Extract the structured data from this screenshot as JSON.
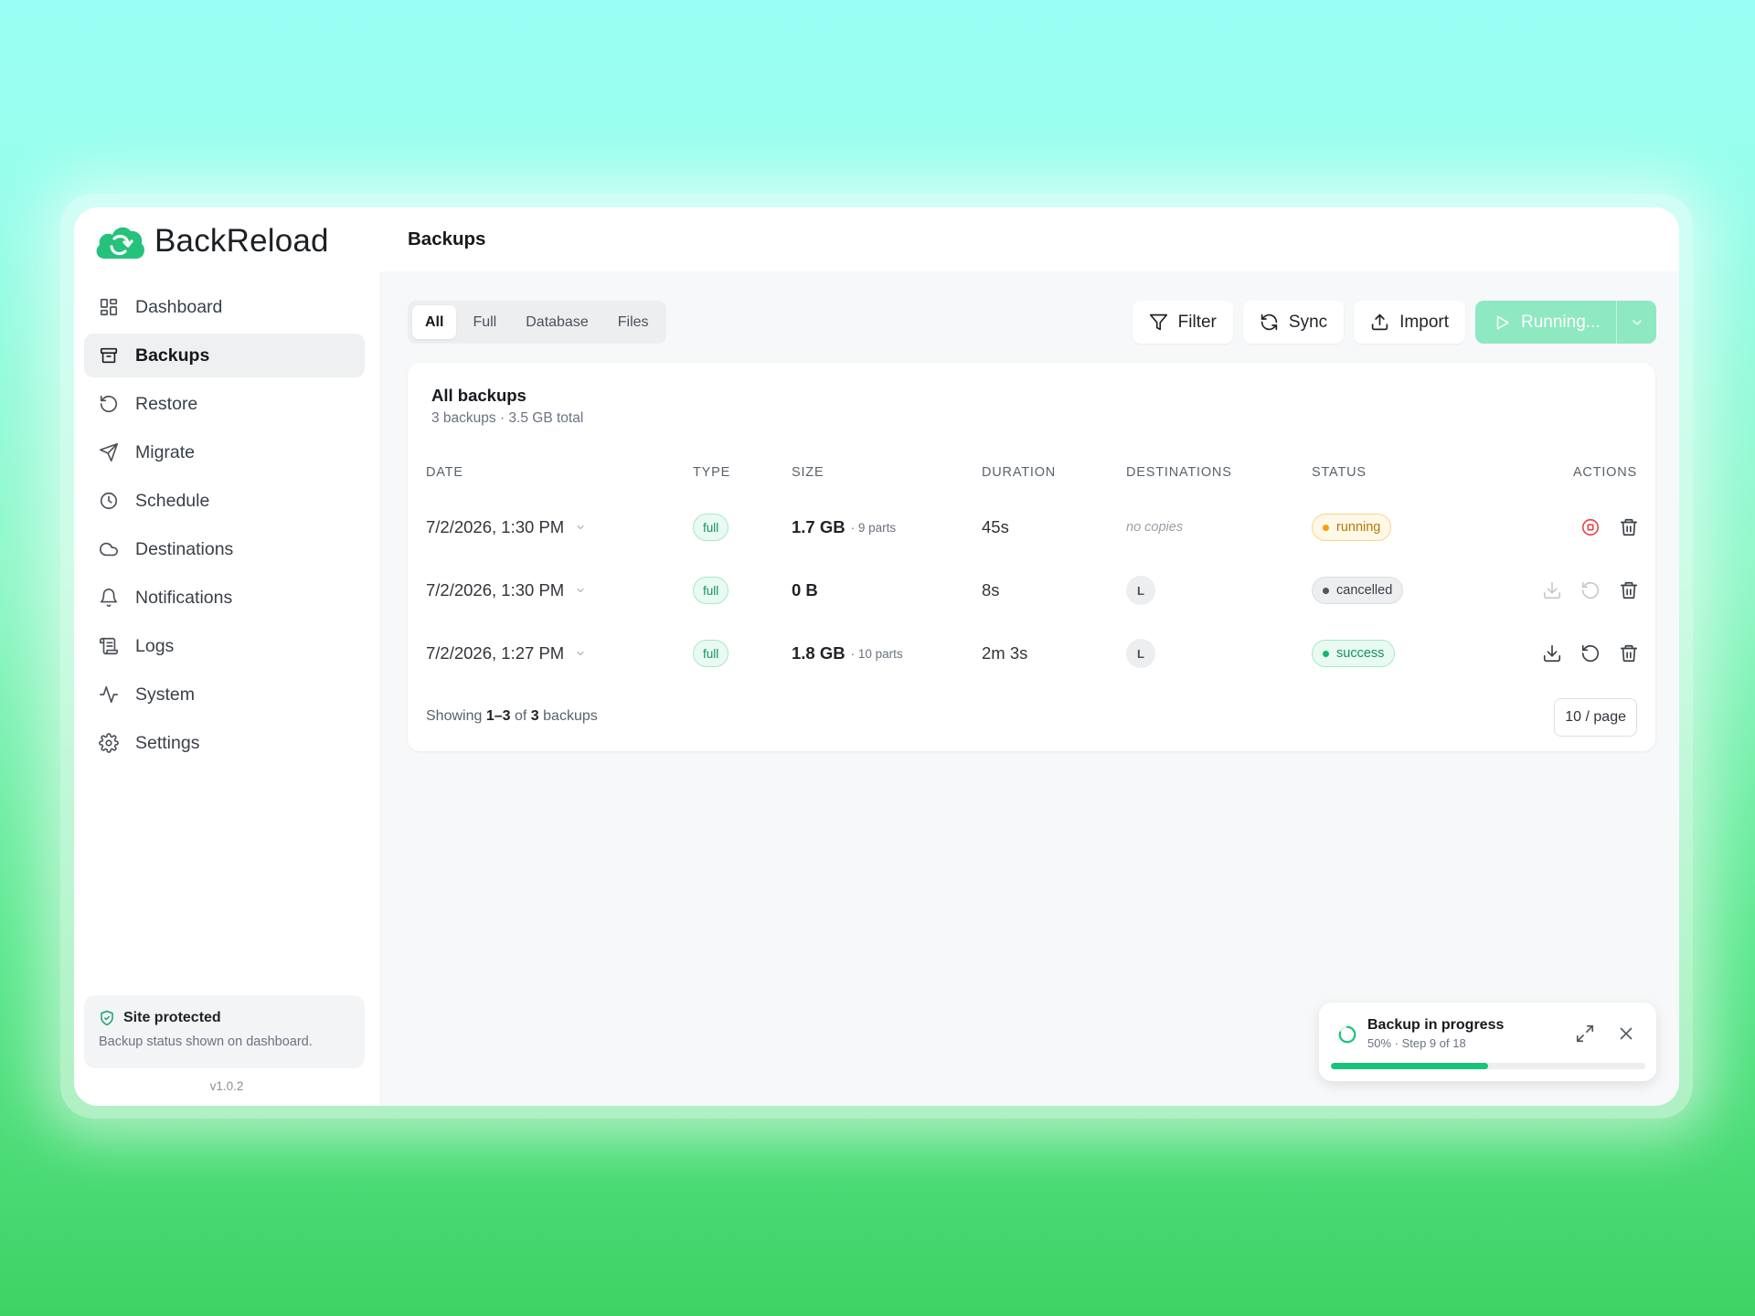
{
  "app": {
    "name": "BackReload",
    "version": "v1.0.2"
  },
  "sidebar": {
    "items": [
      {
        "label": "Dashboard",
        "icon": "dashboard-icon",
        "active": false
      },
      {
        "label": "Backups",
        "icon": "archive-icon",
        "active": true
      },
      {
        "label": "Restore",
        "icon": "restore-icon",
        "active": false
      },
      {
        "label": "Migrate",
        "icon": "send-icon",
        "active": false
      },
      {
        "label": "Schedule",
        "icon": "clock-icon",
        "active": false
      },
      {
        "label": "Destinations",
        "icon": "cloud-icon",
        "active": false
      },
      {
        "label": "Notifications",
        "icon": "bell-icon",
        "active": false
      },
      {
        "label": "Logs",
        "icon": "scroll-icon",
        "active": false
      },
      {
        "label": "System",
        "icon": "activity-icon",
        "active": false
      },
      {
        "label": "Settings",
        "icon": "gear-icon",
        "active": false
      }
    ],
    "protect": {
      "title": "Site protected",
      "subtitle": "Backup status shown on dashboard."
    }
  },
  "header": {
    "title": "Backups"
  },
  "filters": {
    "tabs": [
      "All",
      "Full",
      "Database",
      "Files"
    ],
    "active": "All"
  },
  "toolbar": {
    "filter_label": "Filter",
    "sync_label": "Sync",
    "import_label": "Import",
    "run_label": "Running..."
  },
  "card": {
    "title": "All backups",
    "subtitle": "3 backups · 3.5 GB total",
    "columns": [
      "DATE",
      "TYPE",
      "SIZE",
      "DURATION",
      "DESTINATIONS",
      "STATUS",
      "ACTIONS"
    ],
    "rows": [
      {
        "date": "7/2/2026, 1:30 PM",
        "type": "full",
        "size": "1.7 GB",
        "parts": "· 9 parts",
        "duration": "45s",
        "destinations": "no copies",
        "status": "running"
      },
      {
        "date": "7/2/2026, 1:30 PM",
        "type": "full",
        "size": "0 B",
        "parts": "",
        "duration": "8s",
        "destinations": "L",
        "status": "cancelled"
      },
      {
        "date": "7/2/2026, 1:27 PM",
        "type": "full",
        "size": "1.8 GB",
        "parts": "· 10 parts",
        "duration": "2m 3s",
        "destinations": "L",
        "status": "success"
      }
    ],
    "footer": {
      "showing_prefix": "Showing",
      "range": "1–3",
      "of": "of",
      "total": "3",
      "suffix": "backups"
    },
    "per_page": "10 / page"
  },
  "toast": {
    "title": "Backup in progress",
    "subtitle": "50% · Step 9 of 18",
    "progress": 0.5
  },
  "colors": {
    "accent": "#19c47a",
    "running_button": "#8ee8c2",
    "running": "#f2a20c",
    "danger": "#e5484d"
  }
}
